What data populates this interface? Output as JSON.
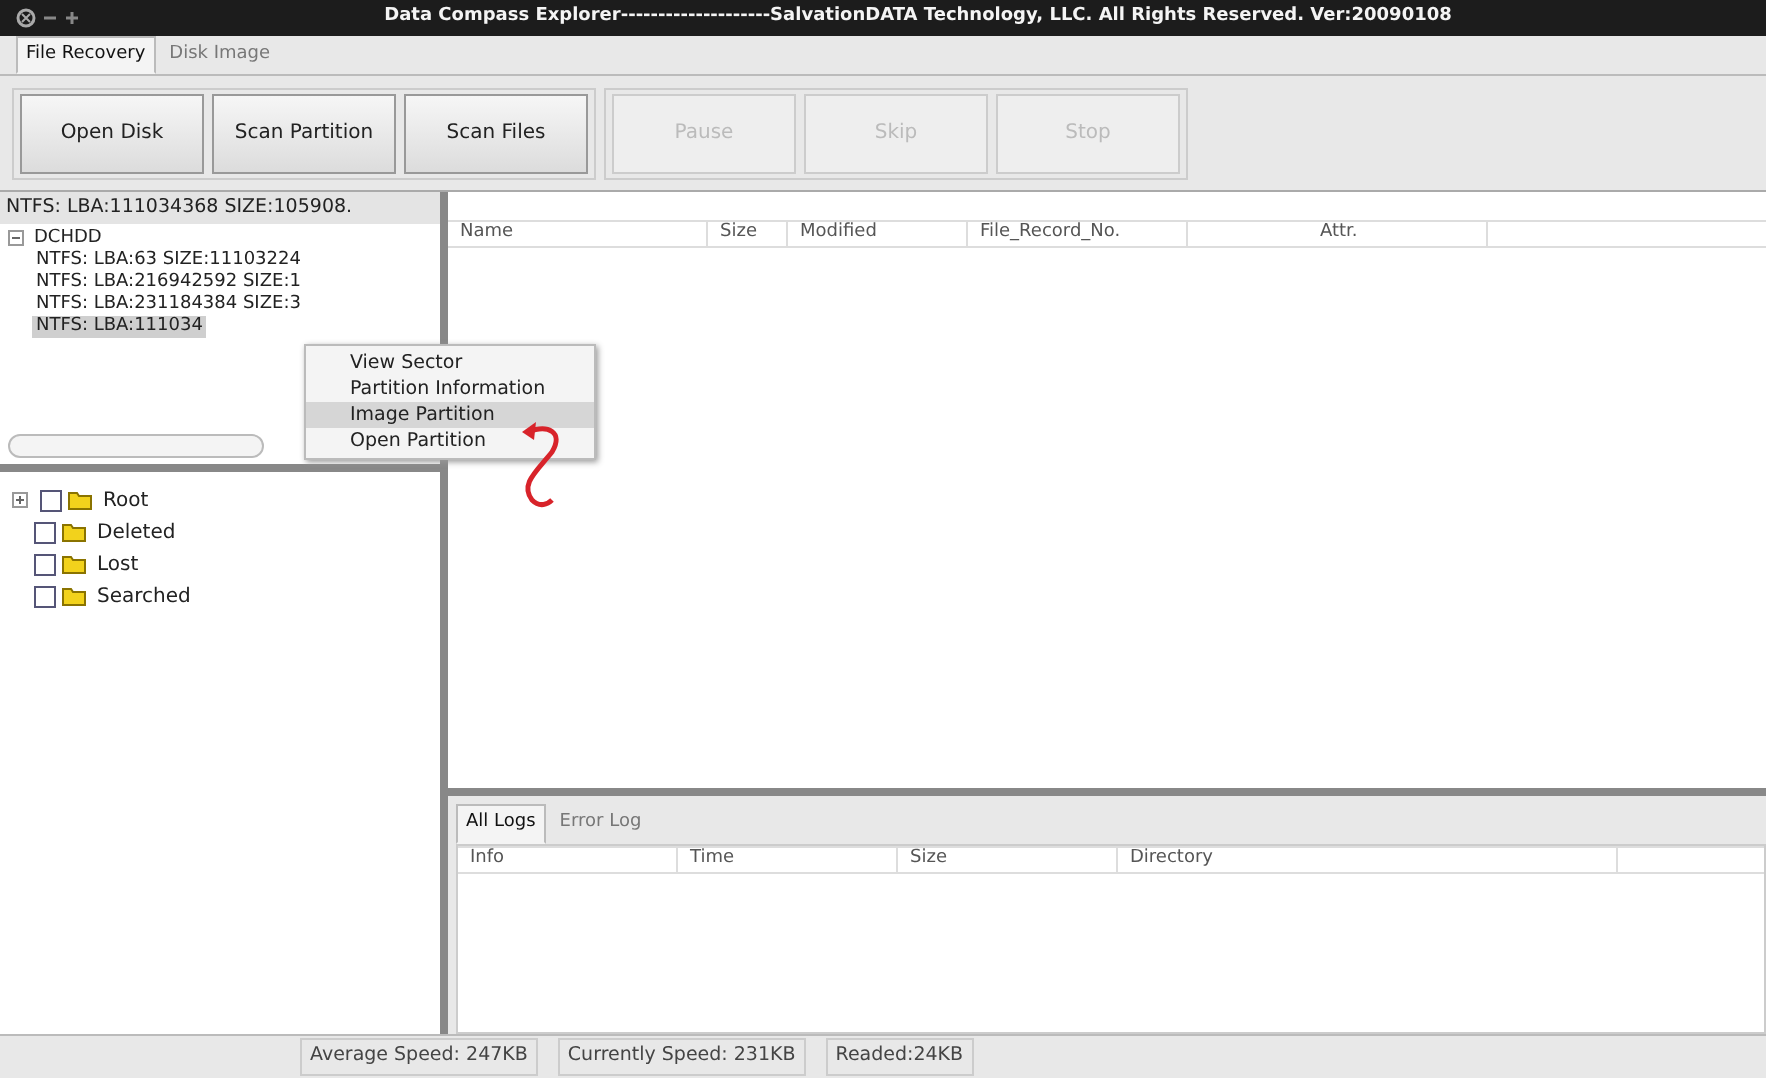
{
  "window": {
    "title": "Data Compass Explorer--------------------SalvationDATA Technology, LLC. All Rights Reserved.   Ver:20090108"
  },
  "tabs": [
    {
      "label": "File Recovery",
      "selected": true
    },
    {
      "label": "Disk Image",
      "selected": false
    }
  ],
  "toolbar": [
    {
      "label": "Open Disk",
      "disabled": false
    },
    {
      "label": "Scan Partition",
      "disabled": false
    },
    {
      "label": "Scan Files",
      "disabled": false
    },
    {
      "label": "Pause",
      "disabled": true
    },
    {
      "label": "Skip",
      "disabled": true
    },
    {
      "label": "Stop",
      "disabled": true
    }
  ],
  "partition_panel": {
    "header": "NTFS: LBA:111034368 SIZE:105908.",
    "tree": [
      {
        "label": "DCHDD",
        "expanded": true,
        "selected": false,
        "children": [
          {
            "label": "NTFS: LBA:63 SIZE:11103224",
            "selected": false
          },
          {
            "label": "NTFS: LBA:216942592 SIZE:1",
            "selected": false
          },
          {
            "label": "NTFS: LBA:231184384 SIZE:3",
            "selected": false
          },
          {
            "label": "NTFS: LBA:111034",
            "selected": true
          }
        ]
      }
    ]
  },
  "context_menu": [
    {
      "label": "View Sector",
      "selected": false
    },
    {
      "label": "Partition Information",
      "selected": false
    },
    {
      "label": "Image Partition",
      "selected": true
    },
    {
      "label": "Open Partition",
      "selected": false
    }
  ],
  "folders": [
    {
      "label": "Root",
      "expandable": true,
      "checked": false
    },
    {
      "label": "Deleted",
      "expandable": false,
      "checked": false
    },
    {
      "label": "Lost",
      "expandable": false,
      "checked": false
    },
    {
      "label": "Searched",
      "expandable": false,
      "checked": false
    }
  ],
  "file_table": {
    "columns": [
      "Name",
      "Size",
      "Modified",
      "File_Record_No.",
      "",
      "Attr."
    ]
  },
  "log_tabs": [
    {
      "label": "All Logs",
      "selected": true
    },
    {
      "label": "Error Log",
      "selected": false
    }
  ],
  "log_table": {
    "columns": [
      "Info",
      "Time",
      "Size",
      "Directory"
    ]
  },
  "status_bar": [
    "Average Speed: 247KB",
    "Currently Speed: 231KB",
    "Readed:24KB"
  ]
}
